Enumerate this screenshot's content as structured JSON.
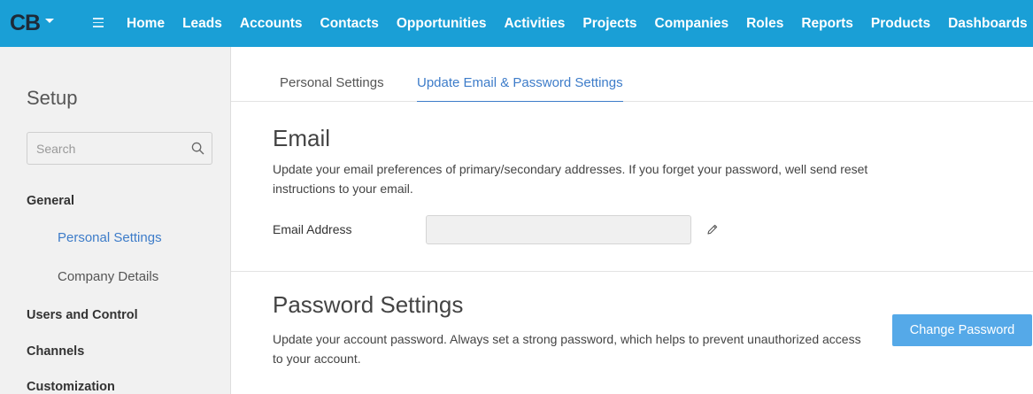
{
  "app": {
    "logo_text": "CB"
  },
  "nav": {
    "items": [
      "Home",
      "Leads",
      "Accounts",
      "Contacts",
      "Opportunities",
      "Activities",
      "Projects",
      "Companies",
      "Roles",
      "Reports",
      "Products",
      "Dashboards"
    ]
  },
  "sidebar": {
    "title": "Setup",
    "search_placeholder": "Search",
    "general": "General",
    "personal_settings": "Personal Settings",
    "company_details": "Company Details",
    "users_and_control": "Users and Control",
    "channels": "Channels",
    "customization": "Customization"
  },
  "tabs": {
    "personal": "Personal Settings",
    "update": "Update Email & Password Settings"
  },
  "email_section": {
    "title": "Email",
    "description": "Update your email preferences of primary/secondary addresses. If you forget your password, well send reset instructions to your email.",
    "field_label": "Email Address",
    "field_value": ""
  },
  "password_section": {
    "title": "Password Settings",
    "description": "Update your account password. Always set a strong password, which helps to prevent unauthorized access to your account.",
    "button_label": "Change Password"
  },
  "colors": {
    "topbar": "#1a9fd6",
    "accent": "#3d7cc9",
    "button": "#55a9e8"
  }
}
